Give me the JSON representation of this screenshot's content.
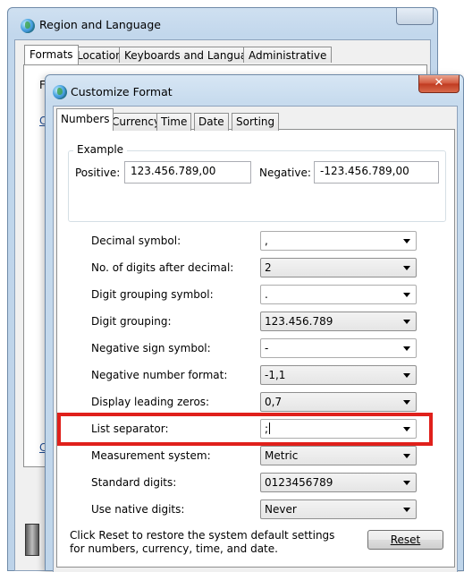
{
  "back_window": {
    "title": "Region and Language",
    "tabs": [
      "Formats",
      "Location",
      "Keyboards and Languages",
      "Administrative"
    ],
    "fragments": [
      "F",
      "C",
      "C"
    ]
  },
  "window": {
    "title": "Customize Format",
    "close_glyph": "✕"
  },
  "tabs": [
    "Numbers",
    "Currency",
    "Time",
    "Date",
    "Sorting"
  ],
  "example": {
    "title": "Example",
    "positive_label": "Positive:",
    "positive_value": "123.456.789,00",
    "negative_label": "Negative:",
    "negative_value": "-123.456.789,00"
  },
  "settings": [
    {
      "label": "Decimal symbol:",
      "value": ","
    },
    {
      "label": "No. of digits after decimal:",
      "value": "2"
    },
    {
      "label": "Digit grouping symbol:",
      "value": "."
    },
    {
      "label": "Digit grouping:",
      "value": "123.456.789"
    },
    {
      "label": "Negative sign symbol:",
      "value": "-"
    },
    {
      "label": "Negative number format:",
      "value": "-1,1"
    },
    {
      "label": "Display leading zeros:",
      "value": "0,7"
    },
    {
      "label": "List separator:",
      "value": ";"
    },
    {
      "label": "Measurement system:",
      "value": "Metric"
    },
    {
      "label": "Standard digits:",
      "value": "0123456789"
    },
    {
      "label": "Use native digits:",
      "value": "Never"
    }
  ],
  "footer": {
    "text": "Click Reset to restore the system default settings for numbers, currency, time, and date.",
    "reset_label": "Reset"
  },
  "colors": {
    "highlight": "#e0201b"
  }
}
